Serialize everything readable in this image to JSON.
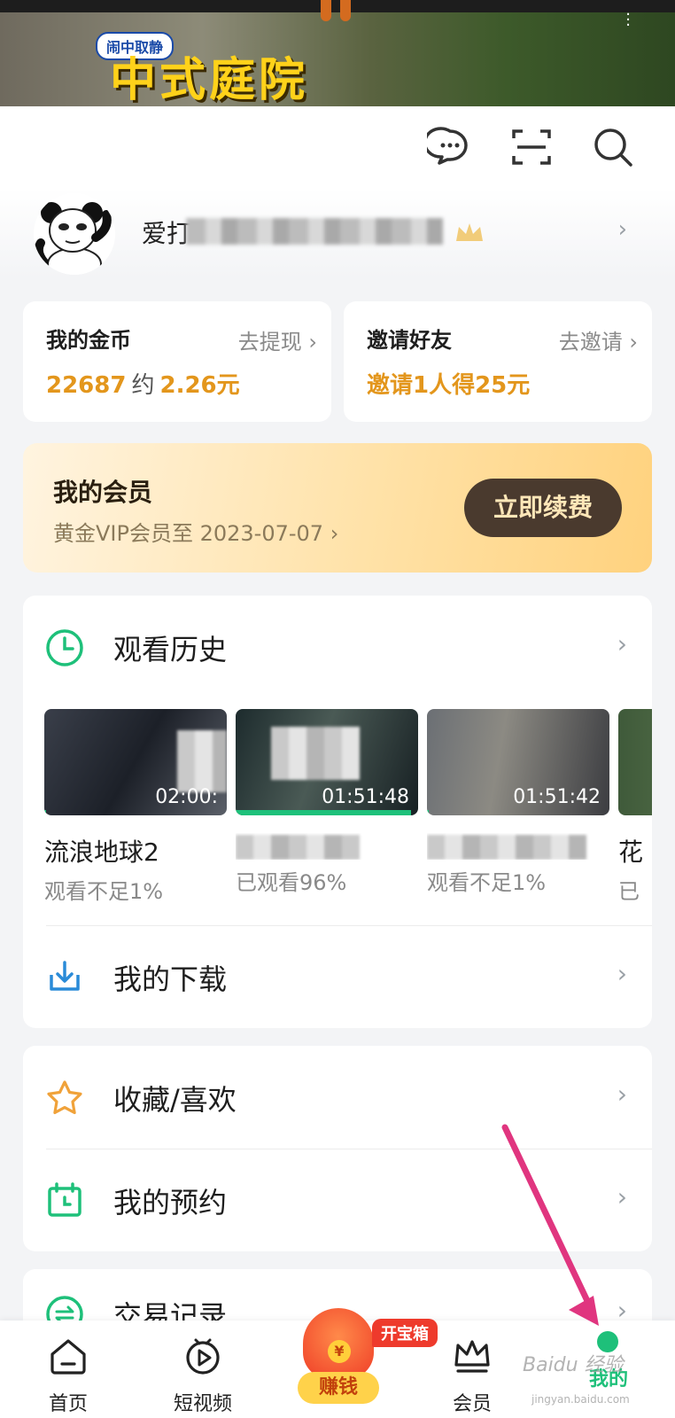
{
  "banner": {
    "tag": "闹中取静",
    "title": "中式庭院"
  },
  "profile": {
    "username_visible": "爱打"
  },
  "coins_card": {
    "title": "我的金币",
    "action": "去提现",
    "coins": "22687",
    "approx": "约",
    "amount": "2.26元"
  },
  "invite_card": {
    "title": "邀请好友",
    "action": "去邀请",
    "reward": "邀请1人得25元"
  },
  "vip": {
    "title": "我的会员",
    "subtitle": "黄金VIP会员至 2023-07-07",
    "button": "立即续费"
  },
  "history": {
    "title": "观看历史",
    "items": [
      {
        "title": "流浪地球2",
        "duration": "02:00:",
        "progress_text": "观看不足1%",
        "progress": 0.01
      },
      {
        "title": "",
        "duration": "01:51:48",
        "progress_text": "已观看96%",
        "progress": 0.96
      },
      {
        "title": "",
        "duration": "01:51:42",
        "progress_text": "观看不足1%",
        "progress": 0.01
      },
      {
        "title": "花",
        "duration": "",
        "progress_text": "已",
        "progress": 0
      }
    ]
  },
  "menu": {
    "download": "我的下载",
    "favorites": "收藏/喜欢",
    "reservation": "我的预约",
    "transactions": "交易记录"
  },
  "tabbar": {
    "home": "首页",
    "shorts": "短视频",
    "earn": "赚钱",
    "earn_badge": "开宝箱",
    "coin_symbol": "¥",
    "vip": "会员",
    "mine": "我的"
  },
  "watermark": {
    "main": "Baidu 经验",
    "sub": "jingyan.baidu.com"
  },
  "colors": {
    "accent_green": "#1ec07a",
    "gold": "#e3961c",
    "arrow": "#e0357f"
  }
}
